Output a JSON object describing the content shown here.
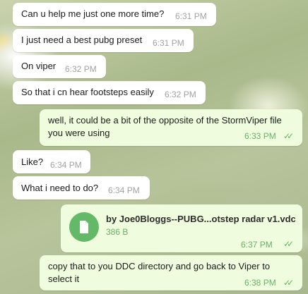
{
  "messages": [
    {
      "text": "Can u help me just one more time?",
      "time": "6:31 PM"
    },
    {
      "text": "I just need a best pubg preset",
      "time": "6:31 PM"
    },
    {
      "text": "On viper",
      "time": "6:32 PM"
    },
    {
      "text": "So that i cn hear footsteps easily",
      "time": "6:32 PM"
    },
    {
      "text": "well, it could be a bit of the opposite of the StormViper file you were using",
      "time": "6:33 PM"
    },
    {
      "text": "Like?",
      "time": "6:34 PM"
    },
    {
      "text": "What i need to do?",
      "time": "6:34 PM"
    },
    {
      "file_name": "by Joe0Bloggs--PUBG...otstep radar v1.vdc",
      "file_size": "386 B",
      "time": "6:37 PM"
    },
    {
      "text": "copy that to you DDC directory and go back to Viper to select it",
      "time": "6:38 PM"
    }
  ],
  "colors": {
    "incoming": "#ffffff",
    "outgoing": "#effdde",
    "accent": "#63b968"
  },
  "icons": {
    "read_receipt": "double-check-icon",
    "file": "file-icon"
  }
}
